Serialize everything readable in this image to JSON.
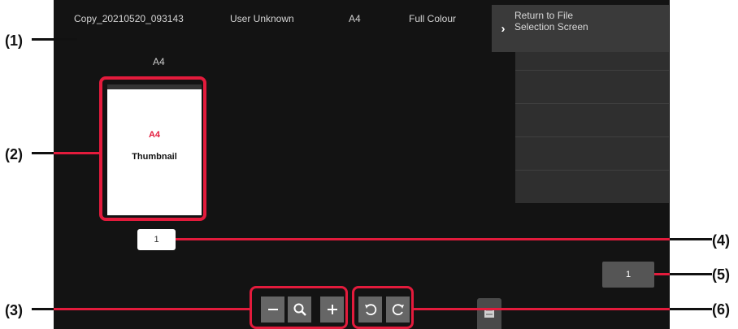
{
  "header": {
    "file_name": "Copy_20210520_093143",
    "user": "User Unknown",
    "paper_size": "A4",
    "color_mode": "Full Colour"
  },
  "return_button": {
    "label": "Return to File Selection Screen",
    "icon": "chevron-right-icon"
  },
  "preview": {
    "paper_size_label": "A4",
    "thumbnail_size_text": "A4",
    "thumbnail_text": "Thumbnail",
    "page_number": "1"
  },
  "pagination": {
    "total_pages": "1"
  },
  "controls": {
    "zoom_out_icon": "minus-icon",
    "zoom_icon": "magnifier-icon",
    "zoom_in_icon": "plus-icon",
    "rotate_left_icon": "rotate-left-icon",
    "rotate_right_icon": "rotate-right-icon",
    "print_icon": "print-icon"
  },
  "callouts": {
    "c1": "(1)",
    "c2": "(2)",
    "c3": "(3)",
    "c4": "(4)",
    "c5": "(5)",
    "c6": "(6)"
  },
  "colors": {
    "highlight": "#e31b3c",
    "screen_background": "#131313",
    "panel": "#2f2f2f"
  }
}
